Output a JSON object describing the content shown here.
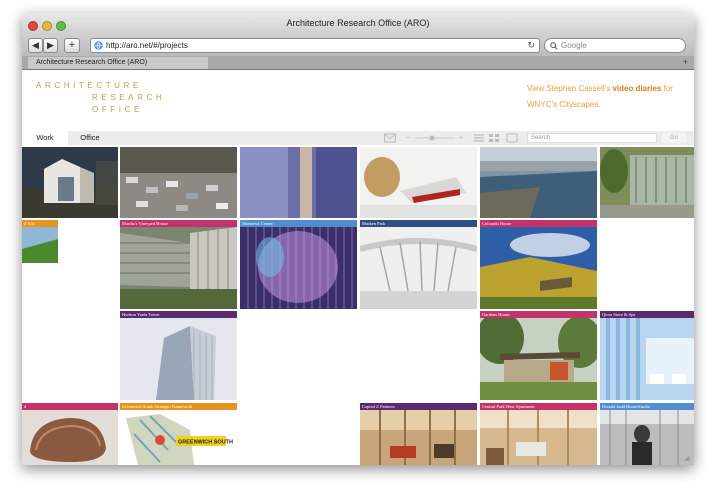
{
  "browser": {
    "window_title": "Architecture Research Office (ARO)",
    "url": "http://aro.net/#/projects",
    "search_placeholder": "Google",
    "tab_title": "Architecture Research Office (ARO)",
    "back_glyph": "◀",
    "forward_glyph": "▶",
    "add_glyph": "+",
    "reload_glyph": "↻",
    "new_tab_glyph": "+"
  },
  "site": {
    "logo": [
      "ARCHITECTURE",
      "RESEARCH",
      "OFFICE"
    ],
    "promo_prefix": "View Stephen Cassell's ",
    "promo_link": "video diaries",
    "promo_suffix": " for WNYC's Cityscapes.",
    "nav": {
      "work": "Work",
      "office": "Office",
      "search_placeholder": "Search",
      "go": "Go",
      "zoom_minus": "−",
      "zoom_plus": "+"
    }
  },
  "colors": {
    "orange": "#e8931f",
    "magenta": "#c4326b",
    "purple": "#5c2a6e",
    "blue": "#4f8fd0",
    "navy": "#2f4f7f",
    "logo": "#b8a64a"
  },
  "tiles": [
    {
      "label": "",
      "band": ""
    },
    {
      "label": "",
      "band": ""
    },
    {
      "label": "",
      "band": ""
    },
    {
      "label": "",
      "band": ""
    },
    {
      "label": "",
      "band": ""
    },
    {
      "label": "",
      "band": ""
    },
    {
      "label": "d Arts",
      "band": "orange"
    },
    {
      "label": "Martha's Vineyard House",
      "band": "magenta"
    },
    {
      "label": "Montreux Center",
      "band": "blue"
    },
    {
      "label": "Marken Park",
      "band": "navy"
    },
    {
      "label": "Colorado House",
      "band": "magenta"
    },
    {
      "label": "Hudson Yards Tower",
      "band": "purple"
    },
    {
      "label": "Gardens House",
      "band": "magenta"
    },
    {
      "label": "Qiora Store & Spa",
      "band": "purple"
    },
    {
      "label": "d",
      "band": "magenta"
    },
    {
      "label": "Greenwich South Strategic Framework",
      "band": "orange"
    },
    {
      "label": "Capital Z Partners",
      "band": "purple"
    },
    {
      "label": "Central Park West Apartment",
      "band": "magenta"
    },
    {
      "label": "Donald Judd Home/Studio",
      "band": "blue"
    }
  ],
  "map_label": "GREENWICH SOUTH"
}
